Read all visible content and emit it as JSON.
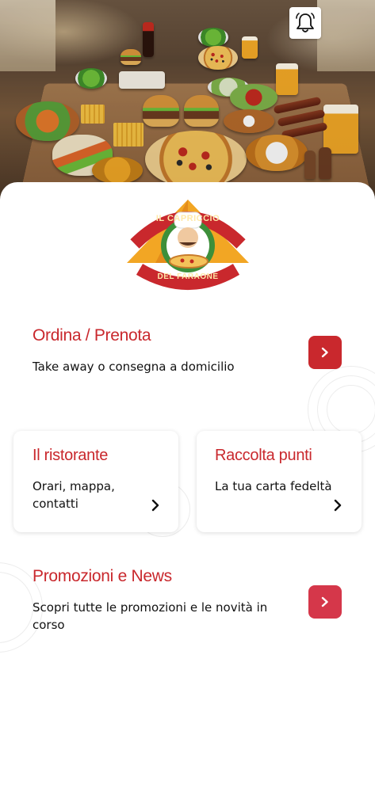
{
  "header": {
    "notification_icon": "bell-icon"
  },
  "brand": {
    "logo_text_top": "IL CAPRICCIO",
    "logo_text_bottom": "DEL FARAONE"
  },
  "sections": {
    "order": {
      "title": "Ordina / Prenota",
      "description": "Take away o consegna a domicilio",
      "icon": "chevron-right-icon"
    },
    "restaurant": {
      "title": "Il ristorante",
      "description": "Orari, mappa, contatti",
      "icon": "chevron-right-icon"
    },
    "loyalty": {
      "title": "Raccolta punti",
      "description": "La tua carta fedeltà",
      "icon": "chevron-right-icon"
    },
    "promotions": {
      "title": "Promozioni e News",
      "description": "Scopri tutte le promozioni e le novità in corso",
      "icon": "chevron-right-icon"
    }
  },
  "colors": {
    "accent": "#c9282d",
    "accent_secondary": "#d5374a",
    "text": "#111111",
    "background": "#ffffff"
  }
}
